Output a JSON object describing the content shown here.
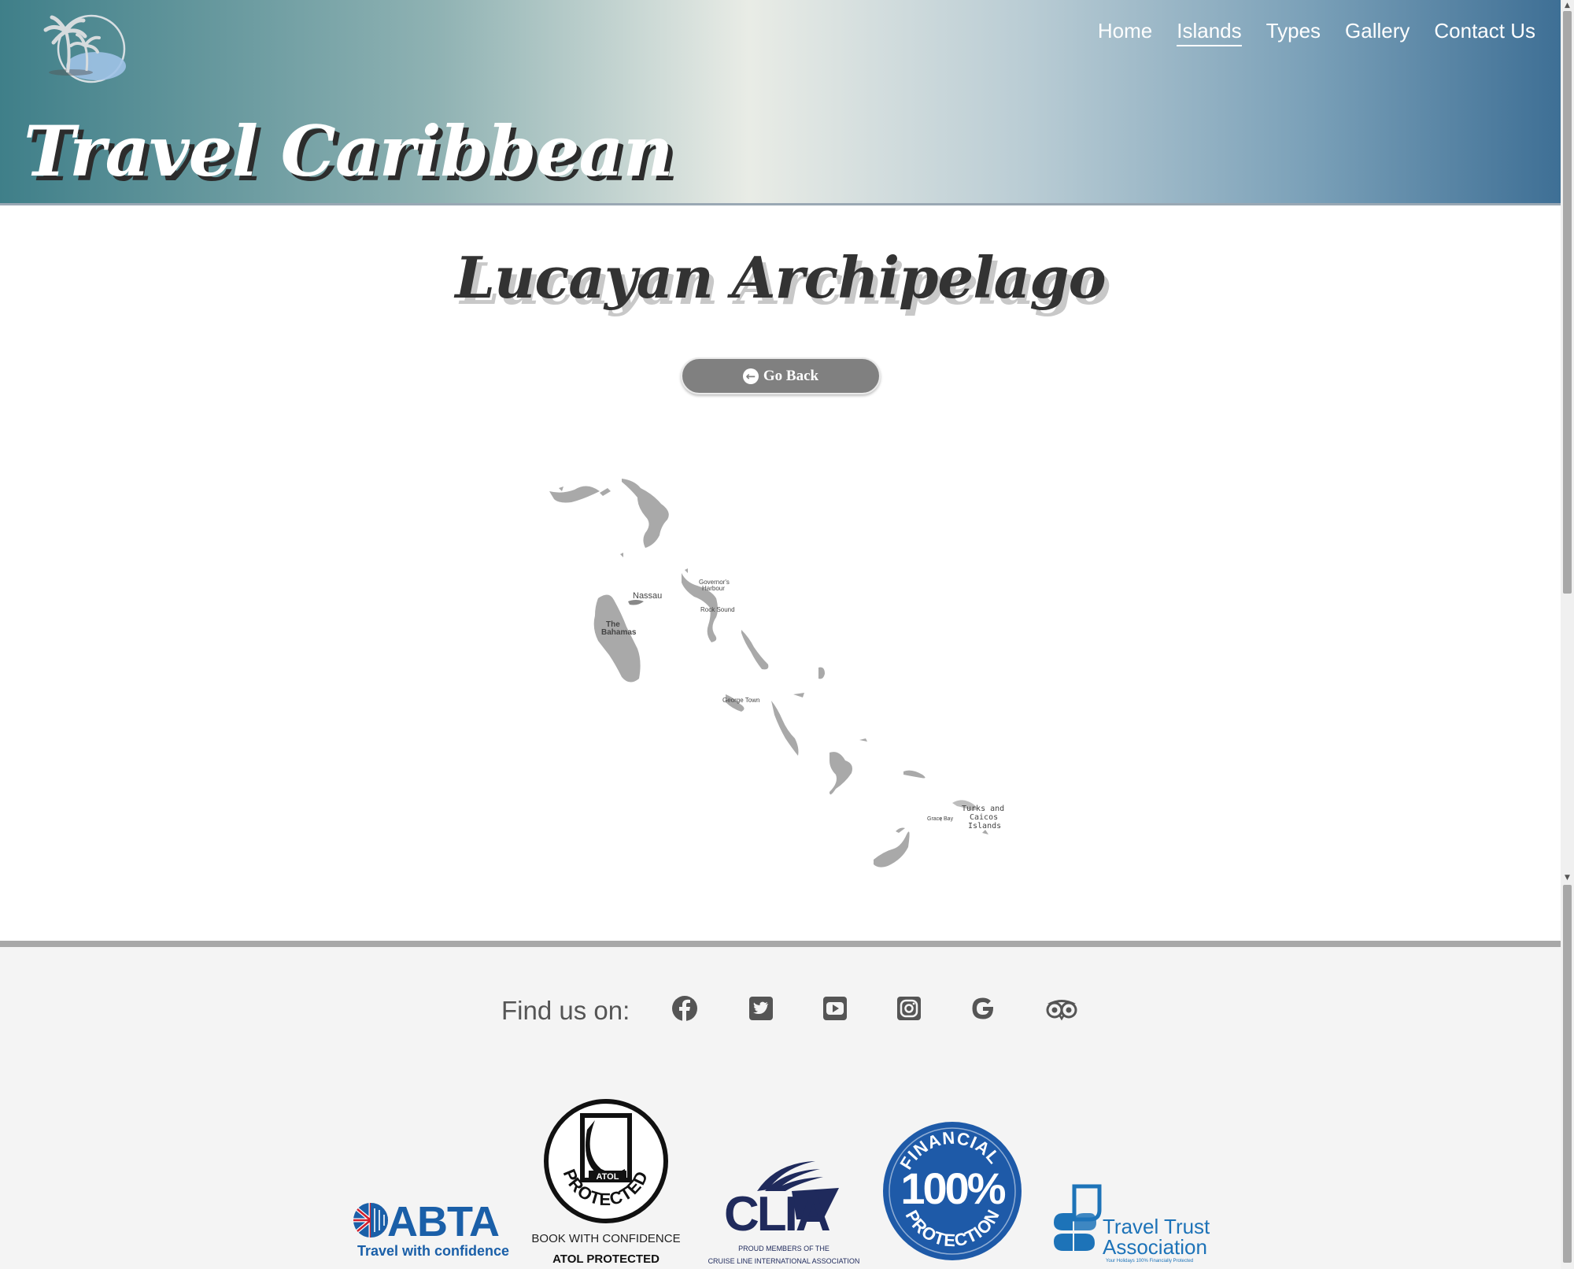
{
  "header": {
    "brand": "Travel Caribbean",
    "nav": [
      {
        "label": "Home",
        "active": false
      },
      {
        "label": "Islands",
        "active": true
      },
      {
        "label": "Types",
        "active": false
      },
      {
        "label": "Gallery",
        "active": false
      },
      {
        "label": "Contact Us",
        "active": false
      }
    ]
  },
  "main": {
    "title": "Lucayan Archipelago",
    "go_back_label": "Go Back",
    "map_labels": {
      "nassau": "Nassau",
      "the_bahamas_1": "The",
      "the_bahamas_2": "Bahamas",
      "governors_harbour_1": "Governor's",
      "governors_harbour_2": "Harbour",
      "rock_sound": "Rock Sound",
      "george_town": "George Town",
      "grace_bay": "Grace Bay",
      "turks_1": "Turks and",
      "turks_2": "Caicos",
      "turks_3": "Islands"
    }
  },
  "footer": {
    "find_us": "Find us on:",
    "social_icons": [
      "facebook-icon",
      "twitter-icon",
      "youtube-icon",
      "instagram-icon",
      "google-icon",
      "tripadvisor-icon"
    ],
    "badges": {
      "abta_name": "ABTA",
      "abta_tagline": "Travel with confidence",
      "atol_word": "ATOL",
      "atol_ring": "PROTECTED",
      "atol_line1": "BOOK WITH CONFIDENCE",
      "atol_line2": "ATOL PROTECTED",
      "clia_name": "CLIA",
      "clia_line1": "PROUD MEMBERS OF THE",
      "clia_line2": "CRUISE LINE INTERNATIONAL ASSOCIATION",
      "fin_top": "FINANCIAL",
      "fin_pct": "100%",
      "fin_bottom": "PROTECTION",
      "tta_line1": "Travel Trust",
      "tta_line2": "Association",
      "tta_small": "Your Holidays 100% Financially Protected"
    }
  },
  "colors": {
    "header_start": "#3f7f89",
    "header_mid": "#e9ece6",
    "header_end": "#3e6f95",
    "button": "#808080",
    "footer_bg": "#f4f4f4",
    "footer_rule": "#a8a8a8",
    "abta_blue": "#1a5fa8",
    "fin_blue": "#1e5aa8",
    "tta_blue": "#1d73b8"
  }
}
